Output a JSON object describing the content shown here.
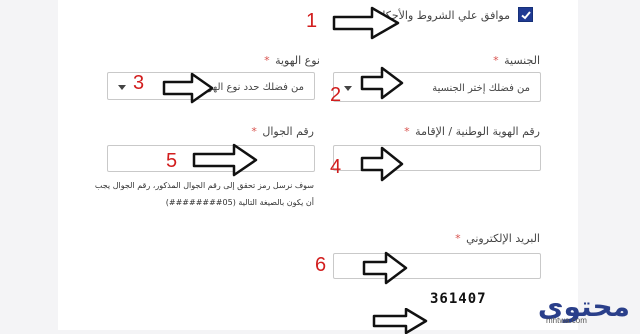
{
  "terms": {
    "label": "موافق علي الشروط والأحكام",
    "checked": true
  },
  "fields": {
    "nationality": {
      "label": "الجنسية",
      "required_mark": "*",
      "placeholder": "من فضلك إختر الجنسية"
    },
    "id_type": {
      "label": "نوع الهوية",
      "required_mark": "*",
      "placeholder": "من فضلك حدد نوع الهوية"
    },
    "national_id": {
      "label": "رقم الهوية الوطنية / الإقامة",
      "required_mark": "*",
      "value": ""
    },
    "mobile": {
      "label": "رقم الجوال",
      "required_mark": "*",
      "value": "",
      "hint_line1": "سوف نرسل رمز تحقق إلى رقم الجوال المذكور، رقم الجوال يجب",
      "hint_line2": "أن يكون بالصيغة التالية  (05########)"
    },
    "email": {
      "label": "البريد الإلكتروني",
      "required_mark": "*",
      "value": ""
    }
  },
  "captcha_text": "361407",
  "annotations": [
    "1",
    "2",
    "3",
    "4",
    "5",
    "6"
  ],
  "watermark": {
    "logo": "محتوى",
    "site": "mhtwa.com"
  },
  "colors": {
    "annotation_red": "#d21e1e",
    "checkbox_blue": "#1f3a93",
    "required_red": "#d9534f",
    "logo_blue": "#2a3f8a"
  }
}
